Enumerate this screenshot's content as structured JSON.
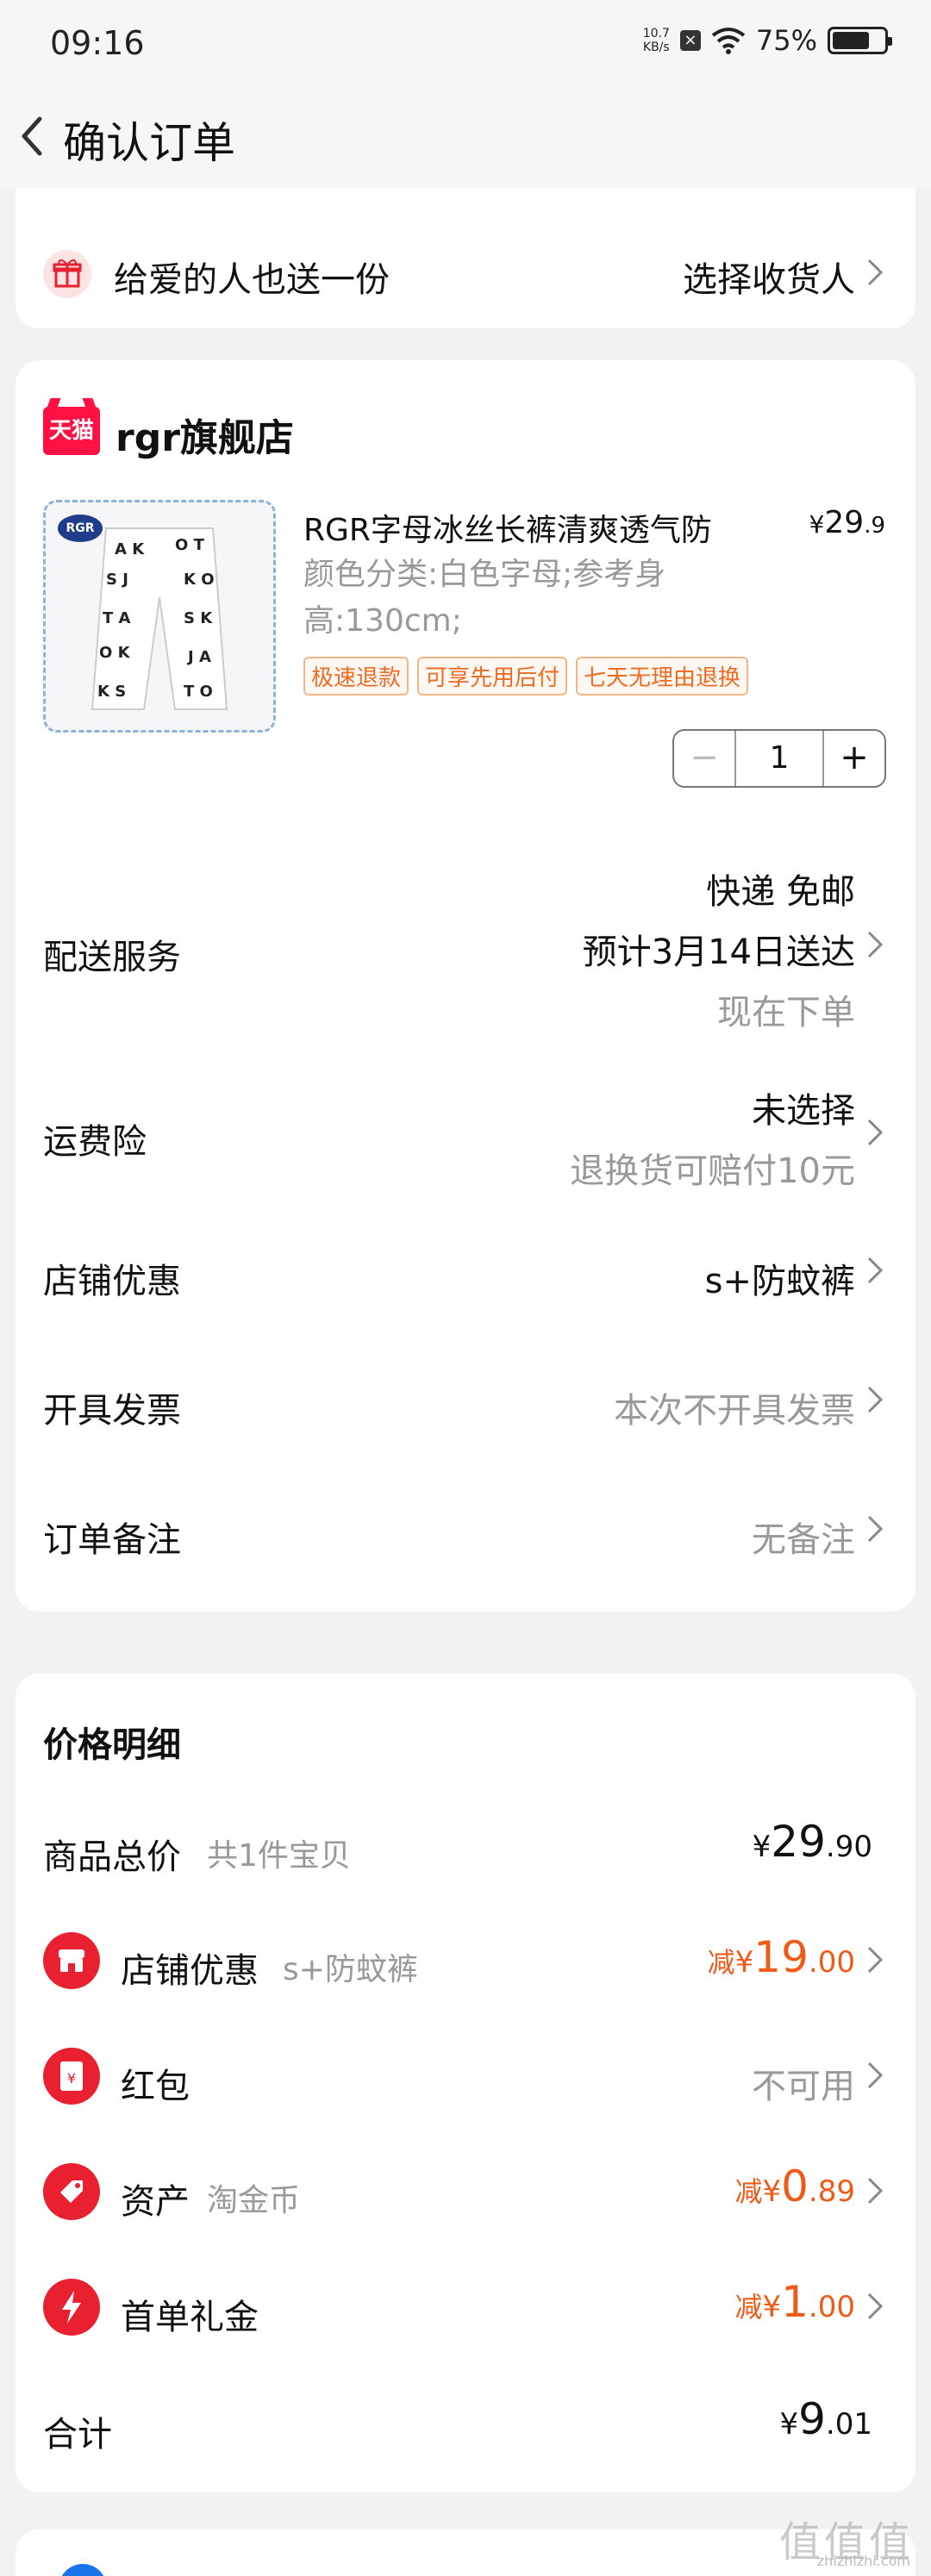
{
  "status_bar": {
    "time": "09:16",
    "net_speed_value": "10.7",
    "net_speed_unit": "KB/s",
    "battery_percent": "75%",
    "battery_level": 0.75
  },
  "nav": {
    "title": "确认订单"
  },
  "gift": {
    "label": "给爱的人也送一份",
    "action": "选择收货人"
  },
  "shop": {
    "badge": "天猫",
    "name": "rgr旗舰店",
    "product": {
      "thumb_badge": "RGR",
      "title": "RGR字母冰丝长裤清爽透气防",
      "price_currency": "¥",
      "price_int": "29",
      "price_dec": ".9",
      "spec_line1": "颜色分类:白色字母;参考身",
      "spec_line2": "高:130cm;",
      "tags": [
        "极速退款",
        "可享先用后付",
        "七天无理由退换"
      ],
      "qty_minus": "−",
      "quantity": "1",
      "qty_plus": "+"
    },
    "rows": {
      "delivery": {
        "label": "配送服务",
        "line1": "快递 免邮",
        "line2": "预计3月14日送达",
        "line3": "现在下单"
      },
      "insurance": {
        "label": "运费险",
        "line1": "未选择",
        "line2": "退换货可赔付10元"
      },
      "shop_discount": {
        "label": "店铺优惠",
        "value": "s+防蚊裤"
      },
      "invoice": {
        "label": "开具发票",
        "value": "本次不开具发票"
      },
      "note": {
        "label": "订单备注",
        "value": "无备注"
      }
    }
  },
  "price_detail": {
    "title": "价格明细",
    "total_goods": {
      "label": "商品总价",
      "sub": "共1件宝贝",
      "cur": "¥",
      "int": "29",
      "dec": ".90"
    },
    "shop_discount": {
      "label": "店铺优惠",
      "sub": "s+防蚊裤",
      "prefix": "减",
      "cur": "¥",
      "int": "19",
      "dec": ".00"
    },
    "red_packet": {
      "label": "红包",
      "value": "不可用",
      "icon_glyph": "¥"
    },
    "assets": {
      "label": "资产",
      "sub": "淘金币",
      "prefix": "减",
      "cur": "¥",
      "int": "0",
      "dec": ".89"
    },
    "first_order": {
      "label": "首单礼金",
      "prefix": "减",
      "cur": "¥",
      "int": "1",
      "dec": ".00"
    },
    "total": {
      "label": "合计",
      "cur": "¥",
      "int": "9",
      "dec": ".01"
    }
  },
  "watermark": {
    "main": "值值值",
    "sub": "zhizhizhi.com"
  },
  "colors": {
    "accent_orange": "#f05a17",
    "tmall_red": "#ff1144",
    "icon_red": "#e8202f"
  },
  "icons": [
    "back-arrow-icon",
    "gift-icon",
    "chevron-right-icon",
    "store-icon",
    "red-packet-icon",
    "tag-icon",
    "lightning-icon"
  ]
}
